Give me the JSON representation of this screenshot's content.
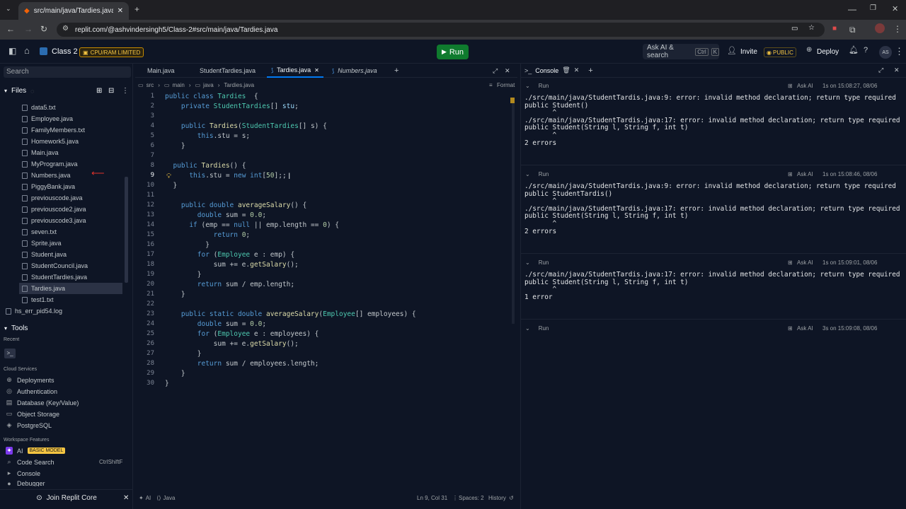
{
  "browser": {
    "tab_title": "src/main/java/Tardies.java - Cla",
    "url": "replit.com/@ashvindersingh5/Class-2#src/main/java/Tardies.java"
  },
  "header": {
    "project": "Class 2",
    "cpu_badge": "CPU/RAM LIMITED",
    "run": "Run",
    "ask_ai": "Ask AI & search",
    "kbd1": "Ctrl",
    "kbd2": "K",
    "invite": "Invite",
    "public": "PUBLIC",
    "deploy": "Deploy",
    "avatar": "AS"
  },
  "sidebar": {
    "search_placeholder": "Search",
    "files_title": "Files",
    "files": [
      "data5.txt",
      "Employee.java",
      "FamilyMembers.txt",
      "Homework5.java",
      "Main.java",
      "MyProgram.java",
      "Numbers.java",
      "PiggyBank.java",
      "previouscode.java",
      "previouscode2.java",
      "previouscode3.java",
      "seven.txt",
      "Sprite.java",
      "Student.java",
      "StudentCouncil.java",
      "StudentTardies.java",
      "Tardies.java",
      "test1.txt"
    ],
    "selected_file": "Tardies.java",
    "log_file": "hs_err_pid54.log",
    "tools_title": "Tools",
    "recent": "Recent",
    "cloud_services": "Cloud Services",
    "cloud_items": [
      "Deployments",
      "Authentication",
      "Database (Key/Value)",
      "Object Storage",
      "PostgreSQL"
    ],
    "workspace_features": "Workspace Features",
    "ai": "AI",
    "ai_badge": "BASIC MODEL",
    "code_search": "Code Search",
    "code_search_kbd": "CtrlShiftF",
    "console": "Console",
    "debugger": "Debugger",
    "join": "Join Replit Core"
  },
  "editor": {
    "tabs": [
      "Main.java",
      "StudentTardies.java",
      "Tardies.java",
      "Numbers.java"
    ],
    "active_tab": "Tardies.java",
    "breadcrumb": [
      "src",
      "main",
      "java",
      "Tardies.java"
    ],
    "format": "Format",
    "status": {
      "ai": "AI",
      "lang": "Java",
      "pos": "Ln 9, Col 31",
      "spaces": "Spaces: 2",
      "history": "History"
    }
  },
  "console": {
    "title": "Console",
    "runs": [
      {
        "label": "Run",
        "ask": "Ask AI",
        "time": "1s on 15:08:27, 08/06",
        "output": "./src/main/java/StudentTardis.java:9: error: invalid method declaration; return type required\npublic Student()\n       ^\n./src/main/java/StudentTardis.java:17: error: invalid method declaration; return type required\npublic Student(String l, String f, int t)\n       ^\n2 errors"
      },
      {
        "label": "Run",
        "ask": "Ask AI",
        "time": "1s on 15:08:46, 08/06",
        "output": "./src/main/java/StudentTardis.java:9: error: invalid method declaration; return type required\npublic StudentTardis()\n       ^\n./src/main/java/StudentTardis.java:17: error: invalid method declaration; return type required\npublic Student(String l, String f, int t)\n       ^\n2 errors"
      },
      {
        "label": "Run",
        "ask": "Ask AI",
        "time": "1s on 15:09:01, 08/06",
        "output": "./src/main/java/StudentTardis.java:17: error: invalid method declaration; return type required\npublic Student(String l, String f, int t)\n       ^\n1 error"
      },
      {
        "label": "Run",
        "ask": "Ask AI",
        "time": "3s on 15:09:08, 08/06",
        "output": ""
      }
    ]
  },
  "code": [
    [
      [
        "kw",
        "public class "
      ],
      [
        "ty",
        "Tardies"
      ],
      [
        "",
        "  {"
      ]
    ],
    [
      [
        "",
        "    "
      ],
      [
        "kw",
        "private "
      ],
      [
        "ty",
        "StudentTardies"
      ],
      [
        "",
        "[] "
      ],
      [
        "va",
        "stu"
      ],
      [
        "",
        ";"
      ]
    ],
    [],
    [
      [
        "",
        "    "
      ],
      [
        "kw",
        "public "
      ],
      [
        "fn",
        "Tardies"
      ],
      [
        "",
        "("
      ],
      [
        "ty",
        "StudentTardies"
      ],
      [
        "",
        "[] s) {"
      ]
    ],
    [
      [
        "",
        "        "
      ],
      [
        "kw",
        "this"
      ],
      [
        "",
        ".stu = s;"
      ]
    ],
    [
      [
        "",
        "    }"
      ]
    ],
    [],
    [
      [
        "",
        "  "
      ],
      [
        "kw",
        "public "
      ],
      [
        "fn",
        "Tardies"
      ],
      [
        "",
        "() {"
      ]
    ],
    [
      [
        "",
        "      "
      ],
      [
        "kw",
        "this"
      ],
      [
        "",
        ".stu = "
      ],
      [
        "kw",
        "new int"
      ],
      [
        "",
        "["
      ],
      [
        "nu",
        "50"
      ],
      [
        "",
        "];;"
      ]
    ],
    [
      [
        "",
        "  }"
      ]
    ],
    [],
    [
      [
        "",
        "    "
      ],
      [
        "kw",
        "public double "
      ],
      [
        "fn",
        "averageSalary"
      ],
      [
        "",
        "() {"
      ]
    ],
    [
      [
        "",
        "        "
      ],
      [
        "kw",
        "double "
      ],
      [
        "",
        "sum = "
      ],
      [
        "nu",
        "0.0"
      ],
      [
        "",
        ";"
      ]
    ],
    [
      [
        "",
        "      "
      ],
      [
        "kw",
        "if "
      ],
      [
        "",
        "(emp == "
      ],
      [
        "kw",
        "null "
      ],
      [
        "",
        "|| emp.length == "
      ],
      [
        "nu",
        "0"
      ],
      [
        "",
        ") {"
      ]
    ],
    [
      [
        "",
        "            "
      ],
      [
        "kw",
        "return "
      ],
      [
        "nu",
        "0"
      ],
      [
        "",
        ";"
      ]
    ],
    [
      [
        "",
        "          }"
      ]
    ],
    [
      [
        "",
        "        "
      ],
      [
        "kw",
        "for "
      ],
      [
        "",
        "("
      ],
      [
        "ty",
        "Employee"
      ],
      [
        "",
        " e : emp) {"
      ]
    ],
    [
      [
        "",
        "            sum += e."
      ],
      [
        "fn",
        "getSalary"
      ],
      [
        "",
        "();"
      ]
    ],
    [
      [
        "",
        "        }"
      ]
    ],
    [
      [
        "",
        "        "
      ],
      [
        "kw",
        "return "
      ],
      [
        "",
        "sum / emp.length;"
      ]
    ],
    [
      [
        "",
        "    }"
      ]
    ],
    [],
    [
      [
        "",
        "    "
      ],
      [
        "kw",
        "public static double "
      ],
      [
        "fn",
        "averageSalary"
      ],
      [
        "",
        "("
      ],
      [
        "ty",
        "Employee"
      ],
      [
        "",
        "[] employees) {"
      ]
    ],
    [
      [
        "",
        "        "
      ],
      [
        "kw",
        "double "
      ],
      [
        "",
        "sum = "
      ],
      [
        "nu",
        "0.0"
      ],
      [
        "",
        ";"
      ]
    ],
    [
      [
        "",
        "        "
      ],
      [
        "kw",
        "for "
      ],
      [
        "",
        "("
      ],
      [
        "ty",
        "Employee"
      ],
      [
        "",
        " e : employees) {"
      ]
    ],
    [
      [
        "",
        "            sum += e."
      ],
      [
        "fn",
        "getSalary"
      ],
      [
        "",
        "();"
      ]
    ],
    [
      [
        "",
        "        }"
      ]
    ],
    [
      [
        "",
        "        "
      ],
      [
        "kw",
        "return "
      ],
      [
        "",
        "sum / employees.length;"
      ]
    ],
    [
      [
        "",
        "    }"
      ]
    ],
    [
      [
        "",
        "}"
      ]
    ]
  ]
}
